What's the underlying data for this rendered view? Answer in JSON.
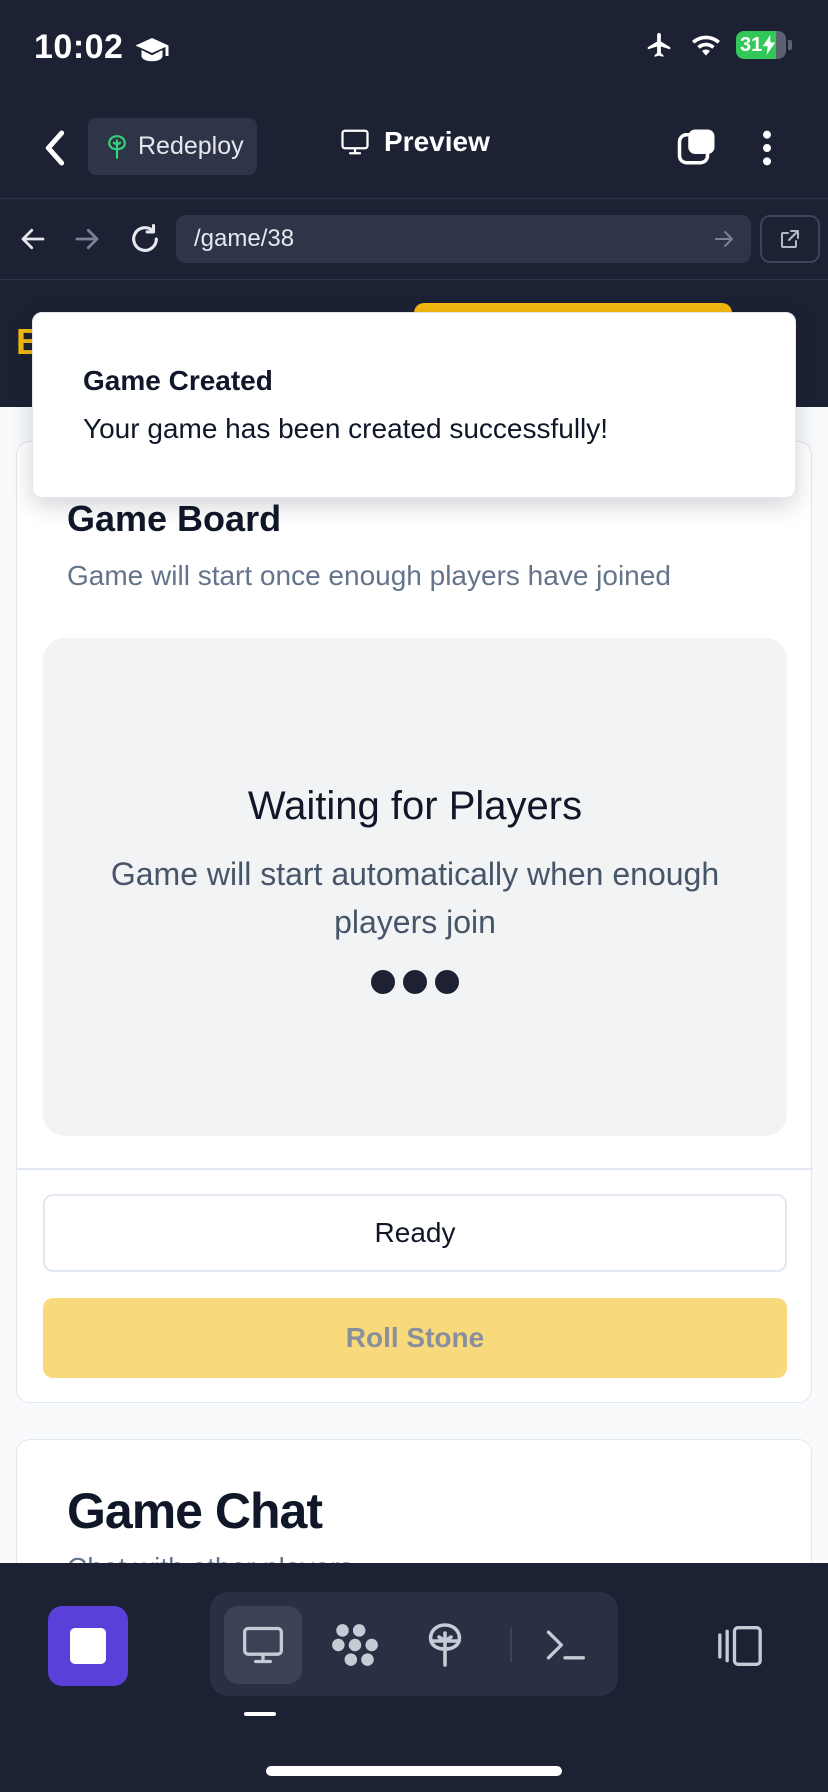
{
  "status_bar": {
    "time": "10:02",
    "battery": "31",
    "battery_level": 0.31
  },
  "app_bar": {
    "redeploy_label": "Redeploy",
    "preview_label": "Preview"
  },
  "browser": {
    "url": "/game/38"
  },
  "site_header": {
    "logo_fragment": "B"
  },
  "toast": {
    "title": "Game Created",
    "message": "Your game has been created successfully!"
  },
  "game_board": {
    "title": "Game Board",
    "subtitle": "Game will start once enough players have joined",
    "waiting_title": "Waiting for Players",
    "waiting_message": "Game will start automatically when enough players join",
    "ready_label": "Ready",
    "roll_label": "Roll Stone"
  },
  "game_chat": {
    "title": "Game Chat",
    "subtitle": "Chat with other players"
  },
  "dock": {
    "tools": [
      "monitor-icon",
      "cluster-icon",
      "deploy-icon",
      "terminal-icon"
    ],
    "active_tool": "monitor-icon"
  },
  "colors": {
    "chrome_bg": "#1c2133",
    "accent_yellow": "#f5b90f",
    "stop_purple": "#5b3fd9",
    "battery_green": "#33c759"
  }
}
